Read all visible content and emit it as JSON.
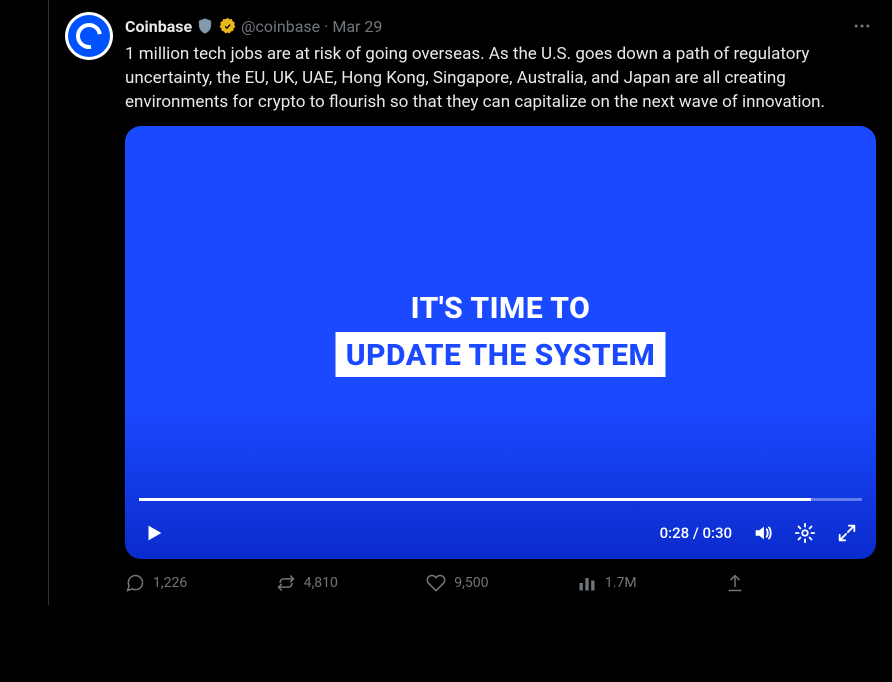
{
  "tweet": {
    "display_name": "Coinbase",
    "handle": "@coinbase",
    "date": "Mar 29",
    "text": "1 million tech jobs are at risk of going overseas. As the U.S. goes down a path of regulatory uncertainty, the EU, UK, UAE, Hong Kong, Singapore, Australia, and Japan are all creating environments for crypto to flourish so that they can capitalize on the next wave of innovation."
  },
  "video": {
    "line1": "IT'S TIME TO",
    "line2": "UPDATE THE SYSTEM",
    "current_time": "0:28",
    "duration": "0:30",
    "time_display": "0:28 / 0:30",
    "progress_pct": 93
  },
  "actions": {
    "replies": "1,226",
    "retweets": "4,810",
    "likes": "9,500",
    "views": "1.7M"
  }
}
